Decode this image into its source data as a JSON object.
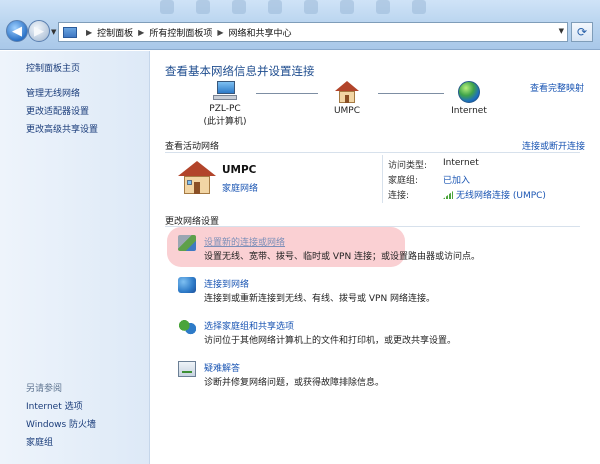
{
  "breadcrumb": [
    "控制面板",
    "所有控制面板项",
    "网络和共享中心"
  ],
  "sidebar": {
    "items": [
      {
        "label": "控制面板主页"
      },
      {
        "label": "管理无线网络"
      },
      {
        "label": "更改适配器设置"
      },
      {
        "label": "更改高级共享设置"
      }
    ],
    "see_also_title": "另请参阅",
    "see_also": [
      {
        "label": "Internet 选项"
      },
      {
        "label": "Windows 防火墙"
      },
      {
        "label": "家庭组"
      }
    ]
  },
  "main": {
    "title": "查看基本网络信息并设置连接",
    "full_map_link": "查看完整映射",
    "map": {
      "pc_name": "PZL-PC",
      "pc_sub": "(此计算机)",
      "network": "UMPC",
      "internet": "Internet"
    },
    "active_title": "查看活动网络",
    "connect_link": "连接或断开连接",
    "active": {
      "name": "UMPC",
      "type_link": "家庭网络",
      "access_label": "访问类型:",
      "access_value": "Internet",
      "homegroup_label": "家庭组:",
      "homegroup_value": "已加入",
      "conn_label": "连接:",
      "conn_value": "无线网络连接 (UMPC)"
    },
    "change_title": "更改网络设置",
    "tasks": [
      {
        "title": "设置新的连接或网络",
        "desc": "设置无线、宽带、拨号、临时或 VPN 连接；或设置路由器或访问点。",
        "icon": "setup-connection-icon"
      },
      {
        "title": "连接到网络",
        "desc": "连接到或重新连接到无线、有线、拨号或 VPN 网络连接。",
        "icon": "connect-network-icon"
      },
      {
        "title": "选择家庭组和共享选项",
        "desc": "访问位于其他网络计算机上的文件和打印机，或更改共享设置。",
        "icon": "homegroup-icon"
      },
      {
        "title": "疑难解答",
        "desc": "诊断并修复网络问题，或获得故障排除信息。",
        "icon": "troubleshoot-icon"
      }
    ]
  },
  "colors": {
    "link": "#1a55b3",
    "title": "#1f4d8f",
    "highlight": "#f5aaaf"
  }
}
